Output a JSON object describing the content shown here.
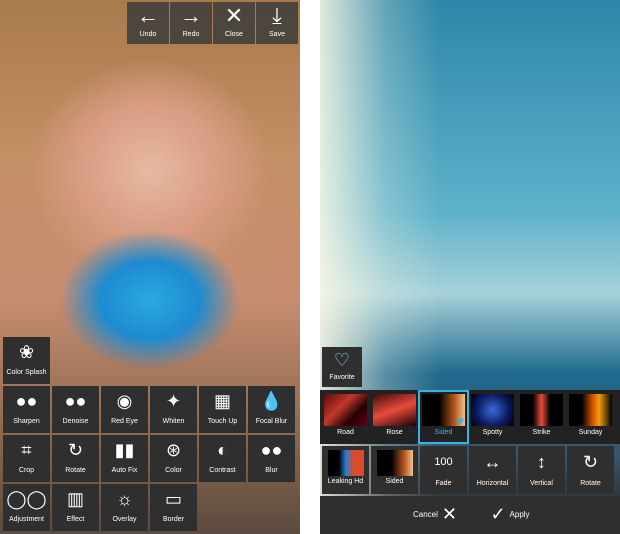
{
  "left_screen": {
    "toolbar": {
      "undo": {
        "label": "Undo",
        "icon": "←"
      },
      "redo": {
        "label": "Redo",
        "icon": "→"
      },
      "close": {
        "label": "Close",
        "icon": "✕"
      },
      "save": {
        "label": "Save",
        "icon": "⤓"
      }
    },
    "tools": [
      {
        "label": "Color Splash",
        "icon": "❀"
      },
      {
        "label": "Sharpen",
        "icon": "●●"
      },
      {
        "label": "Denoise",
        "icon": "●●"
      },
      {
        "label": "Red Eye",
        "icon": "◉"
      },
      {
        "label": "Whiten",
        "icon": "✦"
      },
      {
        "label": "Touch Up",
        "icon": "▦"
      },
      {
        "label": "Focal Blur",
        "icon": "💧"
      },
      {
        "label": "Crop",
        "icon": "⌗"
      },
      {
        "label": "Rotate",
        "icon": "↻"
      },
      {
        "label": "Auto Fix",
        "icon": "▮▮"
      },
      {
        "label": "Color",
        "icon": "⊛"
      },
      {
        "label": "Contrast",
        "icon": "◐"
      },
      {
        "label": "Blur",
        "icon": "●●"
      },
      {
        "label": "Adjustment",
        "icon": "◯◯"
      },
      {
        "label": "Effect",
        "icon": "▥"
      },
      {
        "label": "Overlay",
        "icon": "☼"
      },
      {
        "label": "Border",
        "icon": "▭"
      }
    ]
  },
  "right_screen": {
    "favorite": {
      "label": "Favorite",
      "icon": "♡"
    },
    "effects": [
      {
        "label": "Road",
        "selected": false
      },
      {
        "label": "Rose",
        "selected": false
      },
      {
        "label": "Sided",
        "selected": true
      },
      {
        "label": "Spotty",
        "selected": false
      },
      {
        "label": "Strike",
        "selected": false
      },
      {
        "label": "Sunday",
        "selected": false
      }
    ],
    "controls": [
      {
        "label": "Leaking Hd",
        "icon": ""
      },
      {
        "label": "Sided",
        "icon": ""
      },
      {
        "label": "Fade",
        "icon": "100"
      },
      {
        "label": "Horizontal",
        "icon": "↔"
      },
      {
        "label": "Vertical",
        "icon": "↕"
      },
      {
        "label": "Rotate",
        "icon": "↻"
      }
    ],
    "actions": {
      "cancel": {
        "label": "Cancel",
        "icon": "✕"
      },
      "apply": {
        "label": "Apply",
        "icon": "✓"
      }
    }
  },
  "colors": {
    "toolbar_bg": "#3c3c3c",
    "panel_bg": "#2f2f2f",
    "accent_selected": "#33b5e5",
    "text": "#ffffff"
  }
}
